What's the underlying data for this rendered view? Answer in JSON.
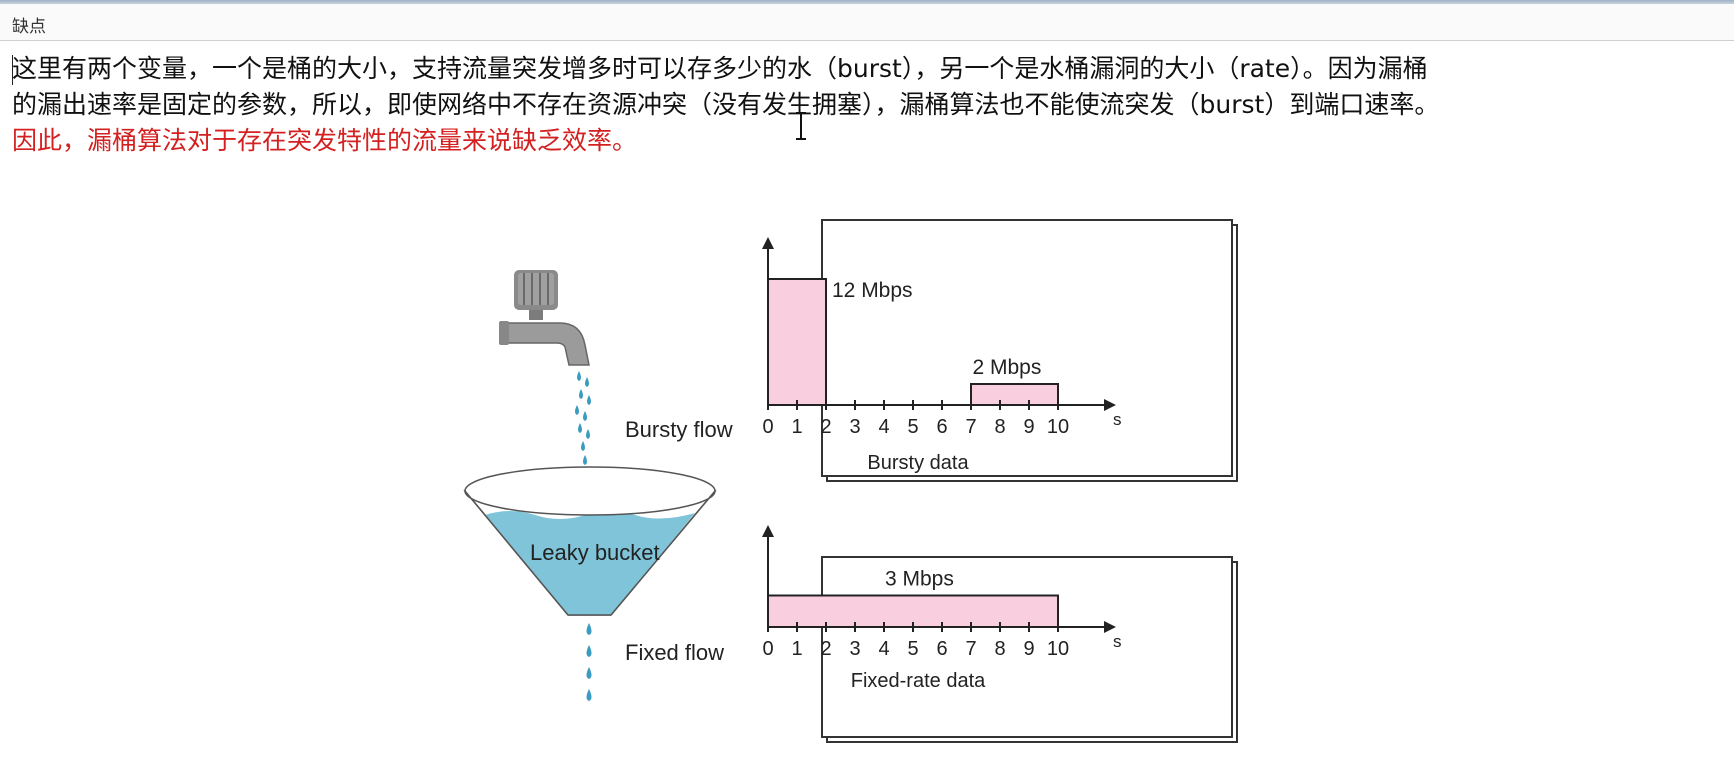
{
  "header": {
    "title": "缺点"
  },
  "paragraph": {
    "line1": "这里有两个变量，一个是桶的大小，支持流量突发增多时可以存多少的水（burst），另一个是水桶漏洞的大小（rate）。因为漏桶",
    "line2": "的漏出速率是固定的参数，所以，即使网络中不存在资源冲突（没有发生拥塞），漏桶算法也不能使流突发（burst）到端口速率。",
    "line3_red": "因此，漏桶算法对于存在突发特性的流量来说缺乏效率。"
  },
  "figure": {
    "bursty_flow_label": "Bursty flow",
    "leaky_bucket_label": "Leaky bucket",
    "fixed_flow_label": "Fixed flow",
    "colors": {
      "bar_fill": "#f9cfe0",
      "water": "#7fc4d8",
      "drop": "#3a9cc0"
    }
  },
  "chart_data": [
    {
      "type": "bar",
      "title": "Bursty data",
      "xlabel": "s",
      "x_ticks": [
        "0",
        "1",
        "2",
        "3",
        "4",
        "5",
        "6",
        "7",
        "8",
        "9",
        "10"
      ],
      "xlim": [
        0,
        10
      ],
      "segments": [
        {
          "x_start": 0,
          "x_end": 2,
          "value": 12,
          "label": "12 Mbps"
        },
        {
          "x_start": 7,
          "x_end": 10,
          "value": 2,
          "label": "2 Mbps"
        }
      ],
      "ylim": [
        0,
        12
      ]
    },
    {
      "type": "bar",
      "title": "Fixed-rate data",
      "xlabel": "s",
      "x_ticks": [
        "0",
        "1",
        "2",
        "3",
        "4",
        "5",
        "6",
        "7",
        "8",
        "9",
        "10"
      ],
      "xlim": [
        0,
        10
      ],
      "segments": [
        {
          "x_start": 0,
          "x_end": 10,
          "value": 3,
          "label": "3 Mbps"
        }
      ],
      "ylim": [
        0,
        12
      ]
    }
  ]
}
